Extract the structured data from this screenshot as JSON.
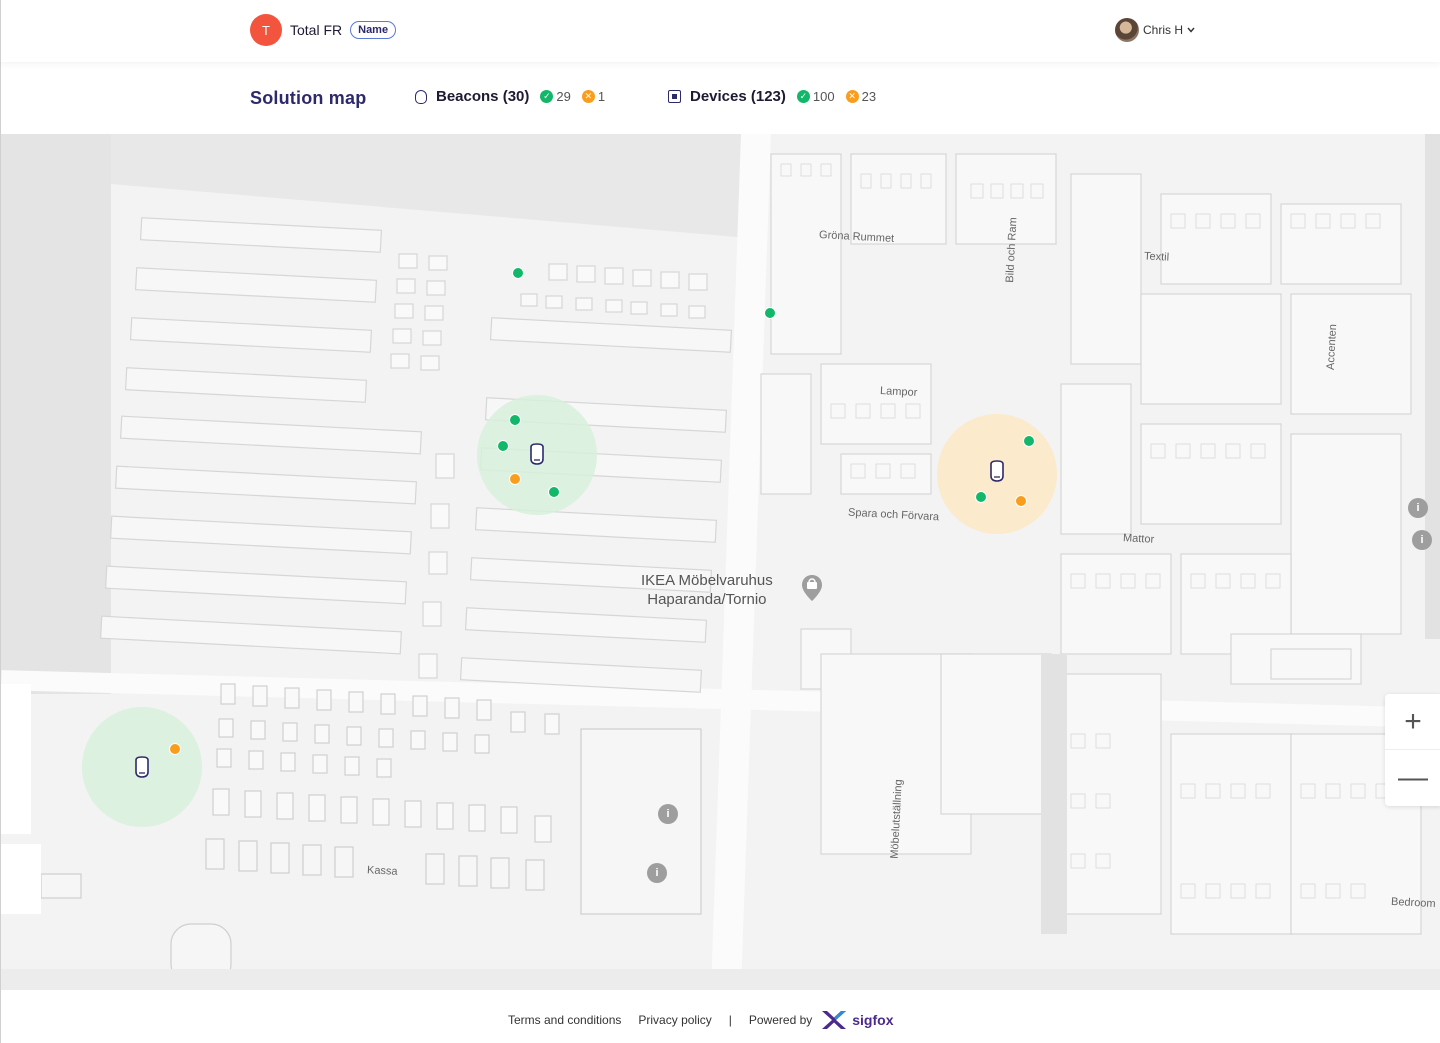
{
  "header": {
    "org_initial": "T",
    "org_name": "Total FR",
    "org_badge": "Name",
    "user_name": "Chris H",
    "user_menu_icon": "chevron-down-icon"
  },
  "subheader": {
    "title": "Solution map",
    "beacons": {
      "label": "Beacons (30)",
      "ok_count": "29",
      "warn_count": "1",
      "icon": "beacon-icon"
    },
    "devices": {
      "label": "Devices (123)",
      "ok_count": "100",
      "warn_count": "23",
      "icon": "device-icon"
    }
  },
  "map": {
    "store_name_line1": "IKEA Möbelvaruhus",
    "store_name_line2": "Haparanda/Tornio",
    "area_labels": [
      "Gröna Rummet",
      "Bild och Ram",
      "Textil",
      "Accenten",
      "Lampor",
      "Spara och Förvara",
      "Mattor",
      "Möbelutställning",
      "Kassa",
      "Bedroom"
    ],
    "zones": [
      {
        "status": "ok",
        "color": "#d7f0da"
      },
      {
        "status": "warn",
        "color": "#fde7c4"
      },
      {
        "status": "ok",
        "color": "#d7f0da"
      }
    ],
    "zoom_in_label": "+",
    "zoom_out_label": "—",
    "info_glyph": "i"
  },
  "colors": {
    "ok": "#12b76a",
    "warn": "#f99d1c",
    "brand": "#2c2a6b",
    "org_avatar": "#f2543d"
  },
  "footer": {
    "terms": "Terms and conditions",
    "privacy": "Privacy policy",
    "separator": "|",
    "powered_by": "Powered by",
    "brand": "sigfox"
  }
}
